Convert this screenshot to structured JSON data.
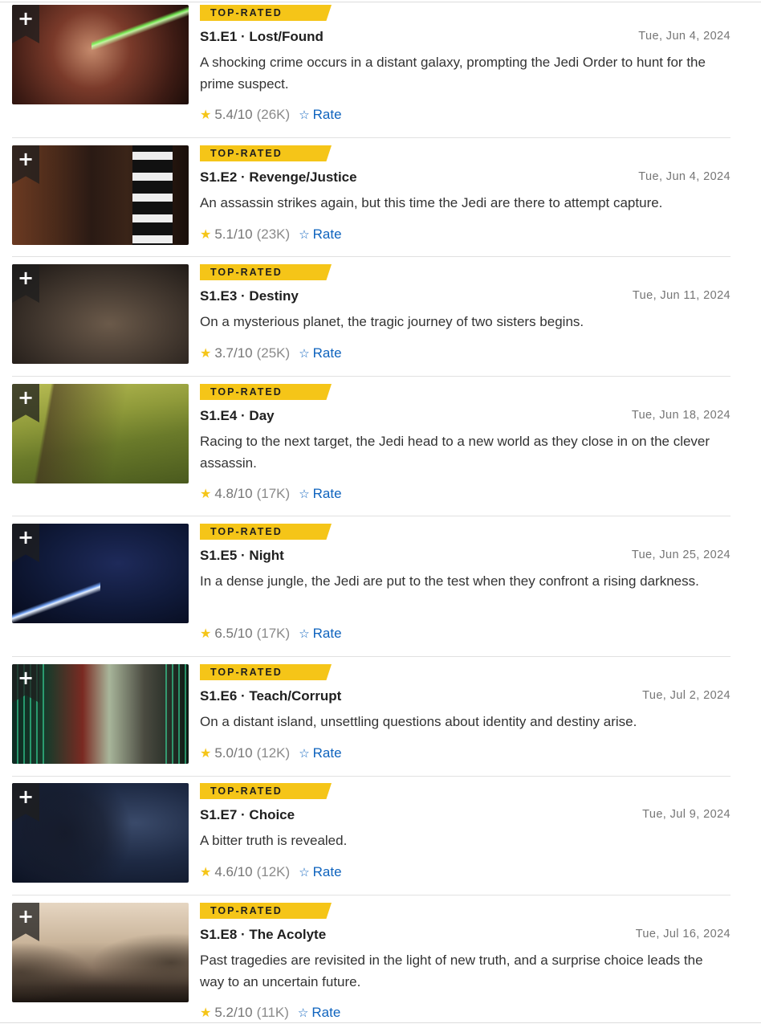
{
  "badge_label": "TOP-RATED",
  "rate_label": "Rate",
  "accent_color": "#f5c518",
  "link_color": "#0e63be",
  "episodes": [
    {
      "code": "S1.E1 · Lost/Found",
      "date": "Tue, Jun 4, 2024",
      "description": "A shocking crime occurs in a distant galaxy, prompting the Jedi Order to hunt for the prime suspect.",
      "score": "5.4/10",
      "votes": "(26K)"
    },
    {
      "code": "S1.E2 · Revenge/Justice",
      "date": "Tue, Jun 4, 2024",
      "description": "An assassin strikes again, but this time the Jedi are there to attempt capture.",
      "score": "5.1/10",
      "votes": "(23K)"
    },
    {
      "code": "S1.E3 · Destiny",
      "date": "Tue, Jun 11, 2024",
      "description": "On a mysterious planet, the tragic journey of two sisters begins.",
      "score": "3.7/10",
      "votes": "(25K)"
    },
    {
      "code": "S1.E4 · Day",
      "date": "Tue, Jun 18, 2024",
      "description": "Racing to the next target, the Jedi head to a new world as they close in on the clever assassin.",
      "score": "4.8/10",
      "votes": "(17K)"
    },
    {
      "code": "S1.E5 · Night",
      "date": "Tue, Jun 25, 2024",
      "description": "In a dense jungle, the Jedi are put to the test when they confront a rising darkness.",
      "score": "6.5/10",
      "votes": "(17K)"
    },
    {
      "code": "S1.E6 · Teach/Corrupt",
      "date": "Tue, Jul 2, 2024",
      "description": "On a distant island, unsettling questions about identity and destiny arise.",
      "score": "5.0/10",
      "votes": "(12K)"
    },
    {
      "code": "S1.E7 · Choice",
      "date": "Tue, Jul 9, 2024",
      "description": "A bitter truth is revealed.",
      "score": "4.6/10",
      "votes": "(12K)"
    },
    {
      "code": "S1.E8 · The Acolyte",
      "date": "Tue, Jul 16, 2024",
      "description": "Past tragedies are revisited in the light of new truth, and a surprise choice leads the way to an uncertain future.",
      "score": "5.2/10",
      "votes": "(11K)"
    }
  ]
}
